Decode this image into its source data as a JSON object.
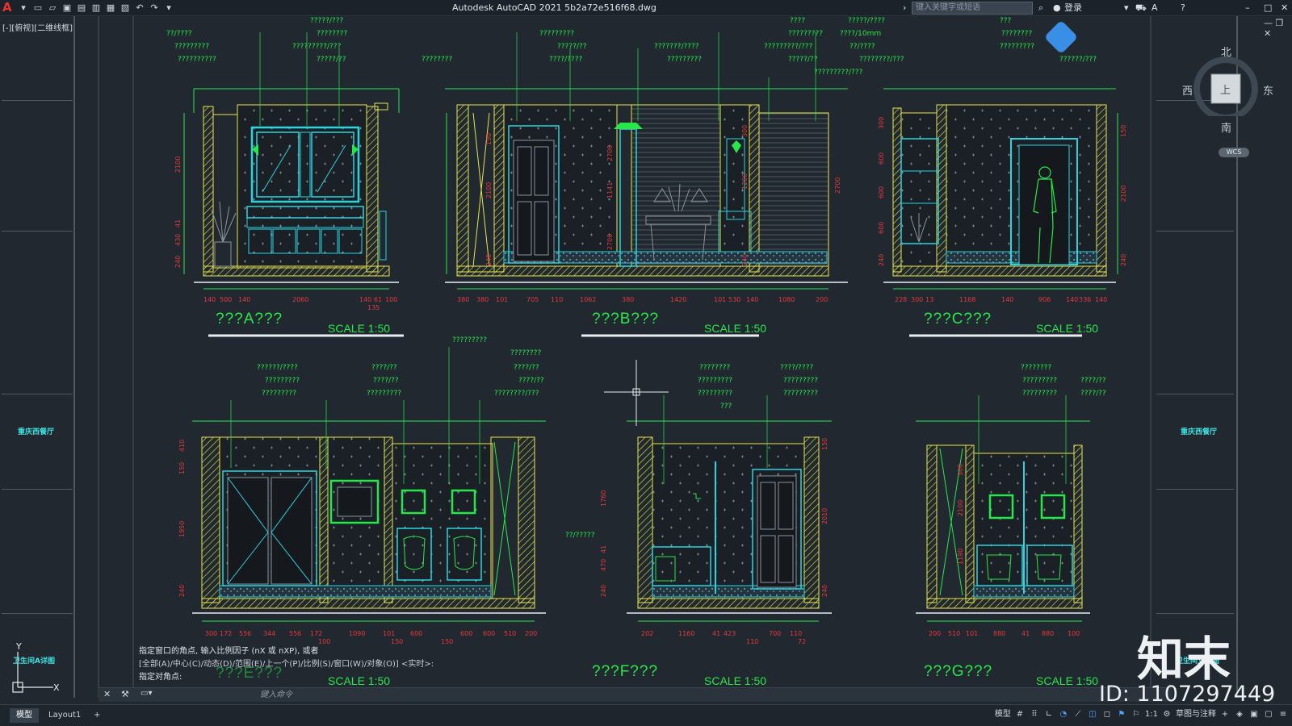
{
  "app": {
    "logo": "A",
    "title": "Autodesk AutoCAD 2021    5b2a72e516f68.dwg",
    "search_placeholder": "键入关键字或短语",
    "login": "登录",
    "viewport_label": "[-][俯视][二维线框]"
  },
  "quick_access": [
    "new-file-icon",
    "open-file-icon",
    "save-icon",
    "save-as-icon",
    "publish-icon",
    "plot-preview-icon",
    "print-icon",
    "undo-icon",
    "redo-icon",
    "workspace-dropdown-icon"
  ],
  "window_controls": [
    "–",
    "□",
    "✕"
  ],
  "viewcube": {
    "north": "北",
    "south": "南",
    "west": "西",
    "east": "东",
    "face": "上",
    "ucs": "WCS"
  },
  "left_panel": {
    "labels": [
      "重庆西餐厅",
      "卫生间A详图"
    ]
  },
  "right_panel": {
    "labels": [
      "重庆西餐厅",
      "卫生间立面图"
    ]
  },
  "elevations": [
    {
      "title": "???A???",
      "scale": "SCALE   1:50"
    },
    {
      "title": "???B???",
      "scale": "SCALE   1:50"
    },
    {
      "title": "???C???",
      "scale": "SCALE   1:50"
    },
    {
      "title": "???E???",
      "scale": "SCALE   1:50"
    },
    {
      "title": "???F???",
      "scale": "SCALE   1:50"
    },
    {
      "title": "???G???",
      "scale": "SCALE   1:50"
    }
  ],
  "dims": {
    "a": [
      "140",
      "500",
      "140",
      "2060",
      "140",
      "61",
      "100",
      "135",
      "140"
    ],
    "b": [
      "380",
      "380",
      "101",
      "705",
      "110",
      "1062",
      "380",
      "1420",
      "101",
      "530",
      "140",
      "1080",
      "200"
    ],
    "c": [
      "228",
      "300",
      "13",
      "1168",
      "140",
      "906",
      "140",
      "336",
      "140"
    ],
    "e": [
      "300",
      "172",
      "556",
      "344",
      "556",
      "172",
      "100",
      "1090",
      "101",
      "600",
      "150",
      "600",
      "150",
      "600",
      "510",
      "200"
    ],
    "f": [
      "202",
      "1160",
      "41",
      "423",
      "110",
      "700",
      "110",
      "72"
    ],
    "g": [
      "200",
      "510",
      "101",
      "880",
      "41",
      "880",
      "100"
    ]
  },
  "command": {
    "history": [
      "指定窗口的角点, 输入比例因子 (nX 或 nXP), 或者",
      "[全部(A)/中心(C)/动态(D)/范围(E)/上一个(P)/比例(S)/窗口(W)/对象(O)] <实时>:",
      "指定对角点:"
    ],
    "placeholder": "键入命令"
  },
  "tabs": {
    "model": "模型",
    "layout": "Layout1",
    "add": "+"
  },
  "status": {
    "model_space": "模型",
    "scale": "1:1",
    "workspace": "草图与注释"
  },
  "watermark": {
    "brand": "知末",
    "id": "ID: 1107297449"
  },
  "colors": {
    "bg": "#212830",
    "wall": "#e6e64a",
    "cyan": "#2ad4e0",
    "green": "#27e84b",
    "red": "#e23b3b",
    "white": "#e8ecef"
  }
}
